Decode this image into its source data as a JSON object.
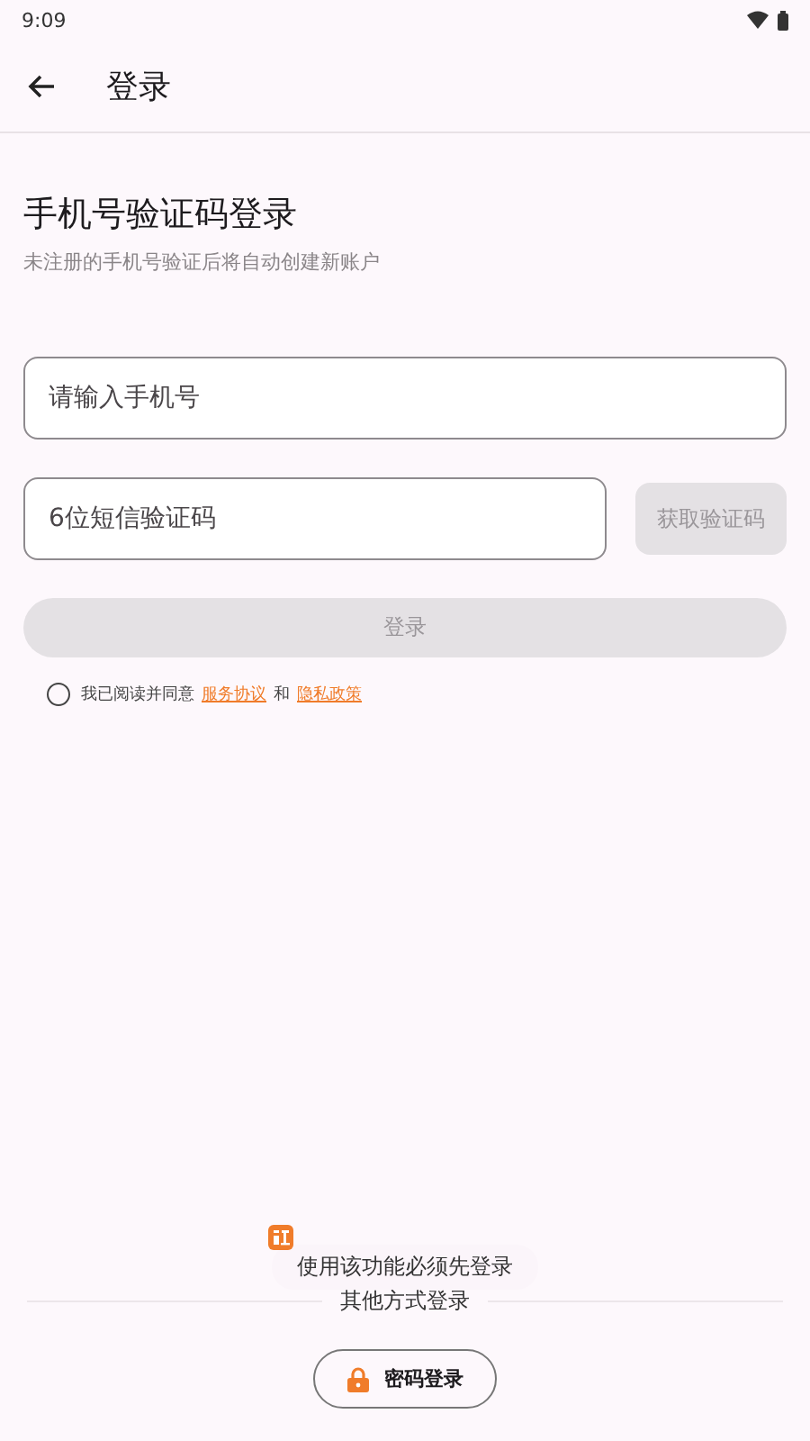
{
  "status_bar": {
    "time": "9:09"
  },
  "header": {
    "title": "登录"
  },
  "heading": "手机号验证码登录",
  "subtitle": "未注册的手机号验证后将自动创建新账户",
  "phone_field": {
    "placeholder": "请输入手机号"
  },
  "code_field": {
    "placeholder": "6位短信验证码"
  },
  "get_code_button": {
    "label": "获取验证码",
    "disabled": true
  },
  "login_button": {
    "label": "登录",
    "disabled": true
  },
  "agreement": {
    "checked": false,
    "text": "我已阅读并同意",
    "service_link": "服务协议",
    "and": "和",
    "privacy_link": "隐私政策"
  },
  "toast": {
    "message": "使用该功能必须先登录"
  },
  "other_methods": {
    "label": "其他方式登录",
    "password_button": "密码登录"
  }
}
